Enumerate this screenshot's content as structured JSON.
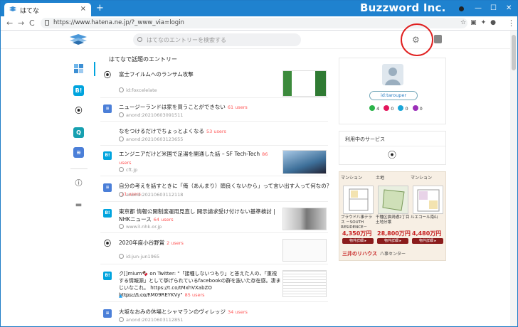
{
  "browser": {
    "tab_title": "はてな",
    "tab_close": "×",
    "new_tab": "+",
    "brand": "Buzzword Inc.",
    "window_min": "—",
    "window_max": "☐",
    "window_close": "✕",
    "back": "←",
    "forward": "→",
    "reload": "C",
    "url": "https://www.hatena.ne.jp/?_www_via=login",
    "menu": "⋮"
  },
  "header": {
    "search_placeholder": "はてなのエントリーを検索する"
  },
  "main": {
    "section_title": "はてなで話題のエントリー",
    "entries": [
      {
        "icon": "hatena",
        "title": "富士フイルムへのランサム攻撃",
        "users": "",
        "source": "id:foxcelelate",
        "has_thumb": true
      },
      {
        "icon": "anond",
        "title": "ニュージーランドは家を買うことができない",
        "users": "61 users",
        "source": "anond:20210603091511",
        "has_thumb": false
      },
      {
        "icon": "none",
        "title": "なをつけるだけでちょっとよくなる",
        "users": "53 users",
        "source": "anond:20210603123655",
        "has_thumb": false
      },
      {
        "icon": "bookmark",
        "title": "エンジニアだけど米国で足湯を開通した話 – SF Tech-Tech",
        "users": "86 users",
        "source": "cft.jp",
        "has_thumb": true
      },
      {
        "icon": "anond",
        "title": "自分の考えを話すときに「俺（あんまり）頭良くないから」って言い出す人って何なの？",
        "users": "11 users",
        "source": "anond:20210603112118",
        "has_thumb": false
      },
      {
        "icon": "bookmark",
        "title": "東京都 情報公開制度運用見直し 開示請求受け付けない基準検討 | NHKニュース",
        "users": "64 users",
        "source": "www3.nhk.or.jp",
        "has_thumb": true
      },
      {
        "icon": "hatena",
        "title": "2020年度小谷野賞",
        "users": "2 users",
        "source": "id:jun-jun1965",
        "has_thumb": true
      },
      {
        "icon": "bookmark",
        "title": "ク[]mium🍫 on Twitter: \"「接種しないつもり」と答えた人の、「重視する情報源」として挙げられているfacebookの群を抜いた存在感。凄まじいなこれ。 https://t.co/tMxhVXabZO https://t.co/FM09REYKVy\"",
        "users": "85 users",
        "source": "twitter.com",
        "has_thumb": true
      },
      {
        "icon": "anond",
        "title": "大坂なおみの休場とシャマランのヴィレッジ",
        "users": "34 users",
        "source": "anond:20210603112851",
        "has_thumb": false
      }
    ]
  },
  "profile": {
    "user_id": "id:tarouper",
    "stars": [
      {
        "color": "#2bb34a",
        "count": "4"
      },
      {
        "color": "#e3155b",
        "count": "0"
      },
      {
        "color": "#1aa6d8",
        "count": "0"
      },
      {
        "color": "#9b2fb8",
        "count": "0"
      }
    ]
  },
  "services": {
    "title": "利用中のサービス"
  },
  "ad": {
    "columns": [
      {
        "kind": "マンション",
        "name": "ブラウド八事テラス －SOUTH RESIDENCE－",
        "price": "4,350万円",
        "button": "物件詳細 ▸"
      },
      {
        "kind": "土地",
        "name": "千種区猫洞通2丁目 土地分譲",
        "price": "28,800万円",
        "button": "物件詳細 ▸"
      },
      {
        "kind": "マンション",
        "name": "ルエコール南山",
        "price": "4,480万円",
        "button": "物件詳細 ▸"
      }
    ],
    "brand": "三井のリハウス",
    "branch": "八事センター"
  }
}
